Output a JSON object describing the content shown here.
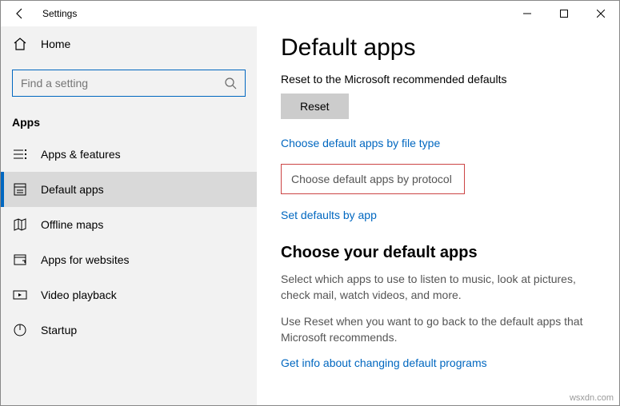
{
  "titlebar": {
    "title": "Settings"
  },
  "sidebar": {
    "home": "Home",
    "search_placeholder": "Find a setting",
    "section": "Apps",
    "items": [
      {
        "label": "Apps & features"
      },
      {
        "label": "Default apps"
      },
      {
        "label": "Offline maps"
      },
      {
        "label": "Apps for websites"
      },
      {
        "label": "Video playback"
      },
      {
        "label": "Startup"
      }
    ]
  },
  "main": {
    "heading": "Default apps",
    "reset_desc": "Reset to the Microsoft recommended defaults",
    "reset_label": "Reset",
    "link_filetype": "Choose default apps by file type",
    "link_protocol": "Choose default apps by protocol",
    "link_byapp": "Set defaults by app",
    "choose_heading": "Choose your default apps",
    "choose_para": "Select which apps to use to listen to music, look at pictures, check mail, watch videos, and more.",
    "reset_para": "Use Reset when you want to go back to the default apps that Microsoft recommends.",
    "link_info": "Get info about changing default programs"
  },
  "watermark": "wsxdn.com"
}
